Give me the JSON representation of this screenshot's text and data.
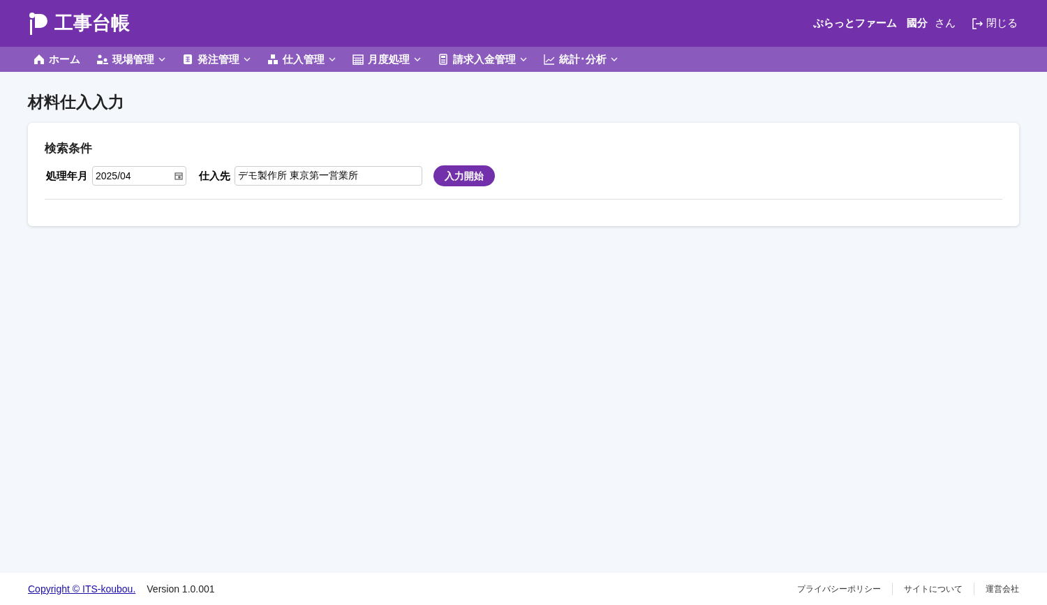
{
  "header": {
    "app_title": "工事台帳",
    "company": "ぷらっとファーム",
    "user_name": "國分",
    "user_suffix": "さん",
    "close_label": "閉じる"
  },
  "nav": [
    {
      "label": "ホーム",
      "dropdown": false
    },
    {
      "label": "現場管理",
      "dropdown": true
    },
    {
      "label": "発注管理",
      "dropdown": true
    },
    {
      "label": "仕入管理",
      "dropdown": true
    },
    {
      "label": "月度処理",
      "dropdown": true
    },
    {
      "label": "請求入金管理",
      "dropdown": true
    },
    {
      "label": "統計･分析",
      "dropdown": true
    }
  ],
  "page_title": "材料仕入入力",
  "search": {
    "title": "検索条件",
    "month_label": "処理年月",
    "month_value": "2025/04",
    "supplier_label": "仕入先",
    "supplier_value": "デモ製作所 東京第一営業所",
    "start_button": "入力開始"
  },
  "footer": {
    "copyright": "Copyright © ITS-koubou.",
    "version": "Version 1.0.001",
    "links": [
      "プライバシーポリシー",
      "サイトについて",
      "運営会社"
    ]
  }
}
